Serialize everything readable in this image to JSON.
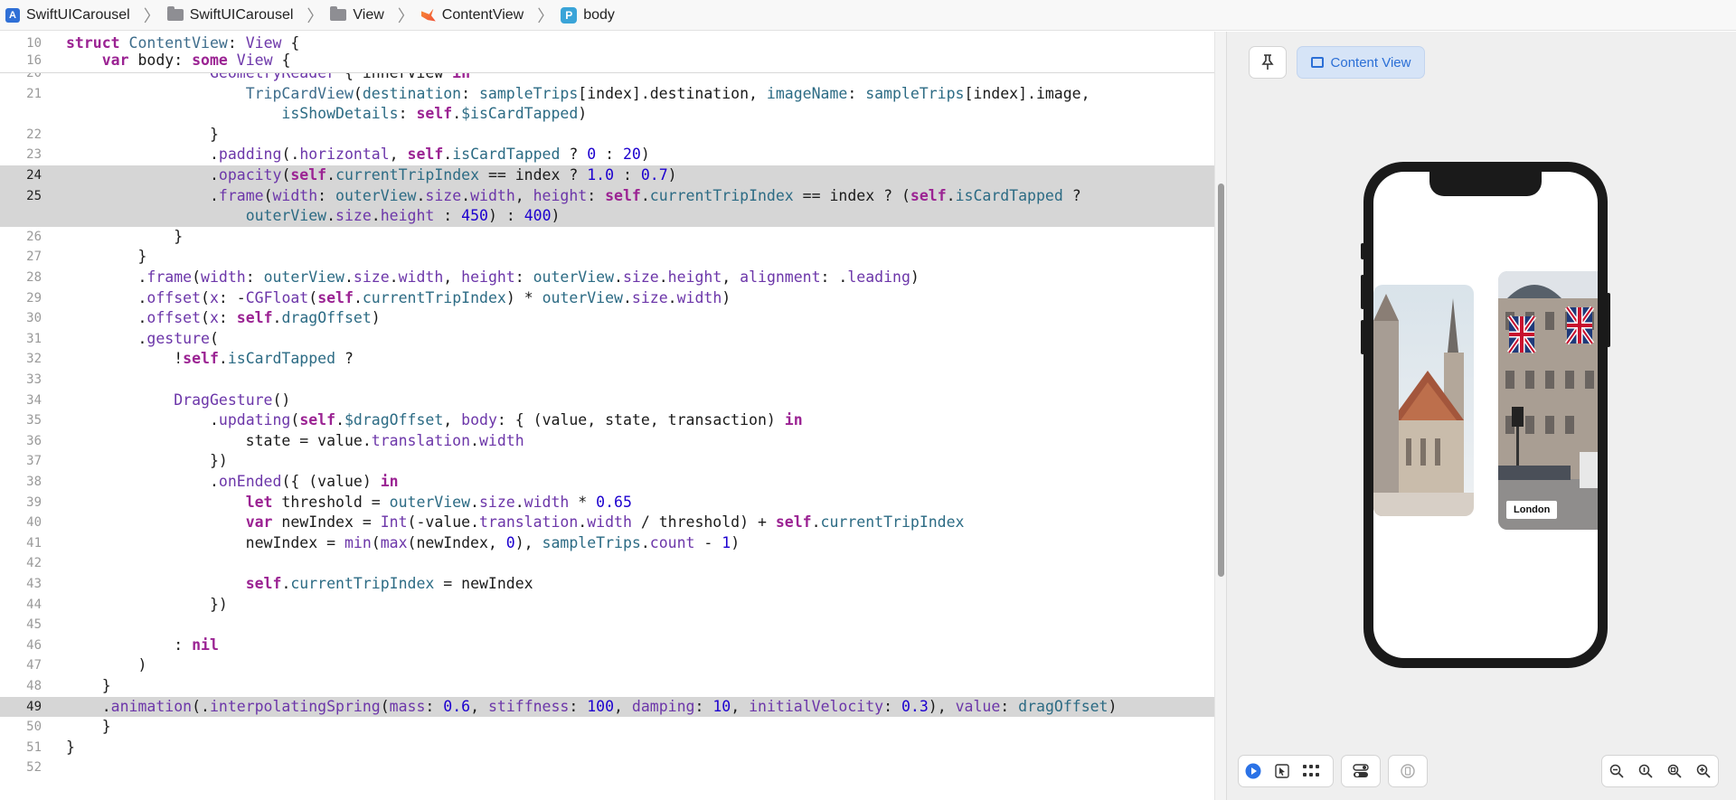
{
  "breadcrumb": [
    {
      "label": "SwiftUICarousel",
      "icon": "project-icon"
    },
    {
      "label": "SwiftUICarousel",
      "icon": "folder-icon"
    },
    {
      "label": "View",
      "icon": "folder-icon"
    },
    {
      "label": "ContentView",
      "icon": "swift-file-icon"
    },
    {
      "label": "body",
      "icon": "property-icon"
    }
  ],
  "sticky_lines": [
    {
      "num": "10",
      "html": "<span class=\"k\">struct</span> <span class=\"t\">ContentView</span>: <span class=\"p\">View</span> {"
    },
    {
      "num": "16",
      "html": "    <span class=\"k\">var</span> body: <span class=\"k\">some</span> <span class=\"p\">View</span> {"
    }
  ],
  "code_lines": [
    {
      "num": "20",
      "html": "                <span class=\"p\">GeometryReader</span> { innerView <span class=\"k\">in</span>"
    },
    {
      "num": "21",
      "html": "                    <span class=\"t\">TripCardView</span>(<span class=\"m\">destination</span>: <span class=\"m\">sampleTrips</span>[index].destination, <span class=\"m\">imageName</span>: <span class=\"m\">sampleTrips</span>[index].image,"
    },
    {
      "num": "",
      "html": "                        <span class=\"m\">isShowDetails</span>: <span class=\"k\">self</span>.<span class=\"m\">$isCardTapped</span>)"
    },
    {
      "num": "22",
      "html": "                }"
    },
    {
      "num": "23",
      "html": "                .<span class=\"p\">padding</span>(.<span class=\"p\">horizontal</span>, <span class=\"k\">self</span>.<span class=\"m\">isCardTapped</span> ? <span class=\"n\">0</span> : <span class=\"n\">20</span>)"
    },
    {
      "num": "24",
      "html": "                .<span class=\"p\">opacity</span>(<span class=\"k\">self</span>.<span class=\"m\">currentTripIndex</span> == index ? <span class=\"n\">1.0</span> : <span class=\"n\">0.7</span>)",
      "hl": true
    },
    {
      "num": "25",
      "html": "                .<span class=\"p\">frame</span>(<span class=\"p\">width</span>: <span class=\"m\">outerView</span>.<span class=\"p\">size</span>.<span class=\"p\">width</span>, <span class=\"p\">height</span>: <span class=\"k\">self</span>.<span class=\"m\">currentTripIndex</span> == index ? (<span class=\"k\">self</span>.<span class=\"m\">isCardTapped</span> ?",
      "hl": true
    },
    {
      "num": "",
      "html": "                    <span class=\"m\">outerView</span>.<span class=\"p\">size</span>.<span class=\"p\">height</span> : <span class=\"n\">450</span>) : <span class=\"n\">400</span>)",
      "hl": true
    },
    {
      "num": "26",
      "html": "            }"
    },
    {
      "num": "27",
      "html": "        }"
    },
    {
      "num": "28",
      "html": "        .<span class=\"p\">frame</span>(<span class=\"p\">width</span>: <span class=\"m\">outerView</span>.<span class=\"p\">size</span>.<span class=\"p\">width</span>, <span class=\"p\">height</span>: <span class=\"m\">outerView</span>.<span class=\"p\">size</span>.<span class=\"p\">height</span>, <span class=\"p\">alignment</span>: .<span class=\"p\">leading</span>)"
    },
    {
      "num": "29",
      "html": "        .<span class=\"p\">offset</span>(<span class=\"p\">x</span>: -<span class=\"p\">CGFloat</span>(<span class=\"k\">self</span>.<span class=\"m\">currentTripIndex</span>) * <span class=\"m\">outerView</span>.<span class=\"p\">size</span>.<span class=\"p\">width</span>)"
    },
    {
      "num": "30",
      "html": "        .<span class=\"p\">offset</span>(<span class=\"p\">x</span>: <span class=\"k\">self</span>.<span class=\"m\">dragOffset</span>)"
    },
    {
      "num": "31",
      "html": "        .<span class=\"p\">gesture</span>("
    },
    {
      "num": "32",
      "html": "            !<span class=\"k\">self</span>.<span class=\"m\">isCardTapped</span> ?"
    },
    {
      "num": "33",
      "html": ""
    },
    {
      "num": "34",
      "html": "            <span class=\"p\">DragGesture</span>()"
    },
    {
      "num": "35",
      "html": "                .<span class=\"p\">updating</span>(<span class=\"k\">self</span>.<span class=\"m\">$dragOffset</span>, <span class=\"p\">body</span>: { (value, state, transaction) <span class=\"k\">in</span>"
    },
    {
      "num": "36",
      "html": "                    state = value.<span class=\"p\">translation</span>.<span class=\"p\">width</span>"
    },
    {
      "num": "37",
      "html": "                })"
    },
    {
      "num": "38",
      "html": "                .<span class=\"p\">onEnded</span>({ (value) <span class=\"k\">in</span>"
    },
    {
      "num": "39",
      "html": "                    <span class=\"k\">let</span> threshold = <span class=\"m\">outerView</span>.<span class=\"p\">size</span>.<span class=\"p\">width</span> * <span class=\"n\">0.65</span>"
    },
    {
      "num": "40",
      "html": "                    <span class=\"k\">var</span> newIndex = <span class=\"p\">Int</span>(-value.<span class=\"p\">translation</span>.<span class=\"p\">width</span> / threshold) + <span class=\"k\">self</span>.<span class=\"m\">currentTripIndex</span>"
    },
    {
      "num": "41",
      "html": "                    newIndex = <span class=\"p\">min</span>(<span class=\"p\">max</span>(newIndex, <span class=\"n\">0</span>), <span class=\"m\">sampleTrips</span>.<span class=\"p\">count</span> - <span class=\"n\">1</span>)"
    },
    {
      "num": "42",
      "html": ""
    },
    {
      "num": "43",
      "html": "                    <span class=\"k\">self</span>.<span class=\"m\">currentTripIndex</span> = newIndex"
    },
    {
      "num": "44",
      "html": "                })"
    },
    {
      "num": "45",
      "html": ""
    },
    {
      "num": "46",
      "html": "            : <span class=\"k\">nil</span>"
    },
    {
      "num": "47",
      "html": "        )"
    },
    {
      "num": "48",
      "html": "    }"
    },
    {
      "num": "49",
      "html": "    .<span class=\"p\">animation</span>(.<span class=\"p\">interpolatingSpring</span>(<span class=\"p\">mass</span>: <span class=\"n\">0.6</span>, <span class=\"p\">stiffness</span>: <span class=\"n\">100</span>, <span class=\"p\">damping</span>: <span class=\"n\">10</span>, <span class=\"p\">initialVelocity</span>: <span class=\"n\">0.3</span>), <span class=\"p\">value</span>: <span class=\"m\">dragOffset</span>)",
      "hl": true
    },
    {
      "num": "50",
      "html": "    }"
    },
    {
      "num": "51",
      "html": "}"
    },
    {
      "num": "52",
      "html": ""
    }
  ],
  "canvas": {
    "pin_icon": "pin-icon",
    "preview_button_label": "Content View",
    "destination_label": "London"
  }
}
